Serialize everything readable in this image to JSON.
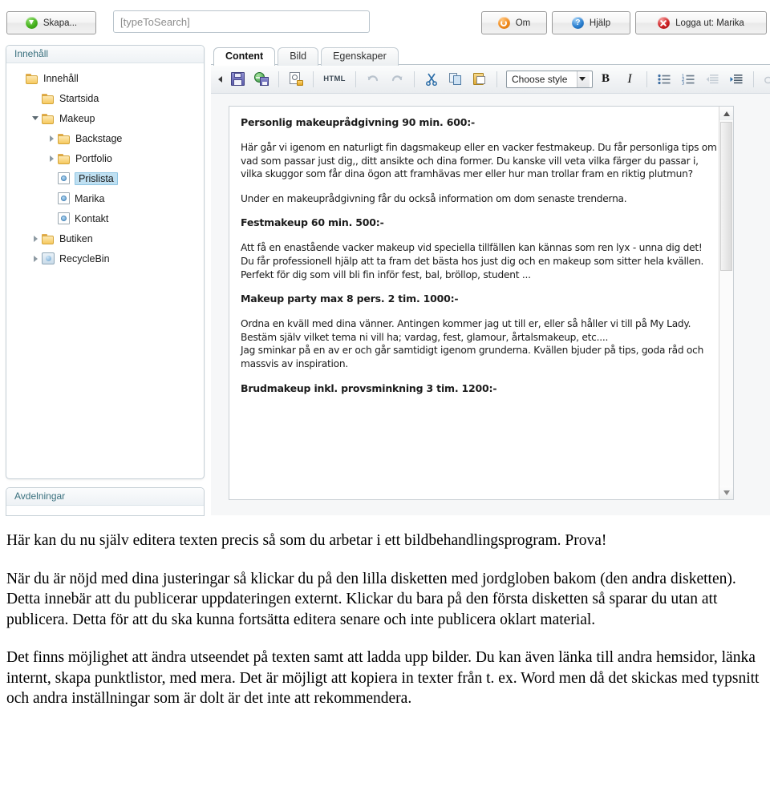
{
  "topbar": {
    "create_button": "Skapa...",
    "search_placeholder": "[typeToSearch]",
    "search_value": "",
    "about_button": "Om",
    "help_button": "Hjälp",
    "logout_button": "Logga ut: Marika"
  },
  "sidebar": {
    "header": "Innehåll",
    "footer_header": "Avdelningar",
    "items": [
      {
        "label": "Innehåll",
        "icon": "folder-icon",
        "twist": "none",
        "depth": 0,
        "selected": false
      },
      {
        "label": "Startsida",
        "icon": "folder-icon",
        "twist": "none",
        "depth": 1,
        "selected": false
      },
      {
        "label": "Makeup",
        "icon": "folder-icon",
        "twist": "open",
        "depth": 1,
        "selected": false
      },
      {
        "label": "Backstage",
        "icon": "folder-icon",
        "twist": "closed",
        "depth": 2,
        "selected": false
      },
      {
        "label": "Portfolio",
        "icon": "folder-icon",
        "twist": "closed",
        "depth": 2,
        "selected": false
      },
      {
        "label": "Prislista",
        "icon": "page-icon",
        "twist": "none",
        "depth": 2,
        "selected": true
      },
      {
        "label": "Marika",
        "icon": "page-icon",
        "twist": "none",
        "depth": 2,
        "selected": false
      },
      {
        "label": "Kontakt",
        "icon": "page-icon",
        "twist": "none",
        "depth": 2,
        "selected": false
      },
      {
        "label": "Butiken",
        "icon": "folder-icon",
        "twist": "closed",
        "depth": 1,
        "selected": false
      },
      {
        "label": "RecycleBin",
        "icon": "recyclebin-icon",
        "twist": "closed",
        "depth": 1,
        "selected": false
      }
    ]
  },
  "editor": {
    "tabs": [
      {
        "label": "Content",
        "active": true
      },
      {
        "label": "Bild",
        "active": false
      },
      {
        "label": "Egenskaper",
        "active": false
      }
    ],
    "toolbar": {
      "collapse": "collapse-toolbar",
      "save": "save-icon",
      "save_publish": "save-and-publish-icon",
      "preview": "preview-icon",
      "html_label": "HTML",
      "undo": "undo-icon",
      "redo": "redo-icon",
      "cut": "cut-icon",
      "copy": "copy-icon",
      "paste": "paste-icon",
      "style_label": "Choose style",
      "bold_label": "B",
      "italic_label": "I",
      "bullet_list": "bullet-list-icon",
      "numbered_list": "numbered-list-icon",
      "outdent": "outdent-icon",
      "indent": "indent-icon",
      "link": "link-icon"
    },
    "content": {
      "heading1": "Personlig makeuprådgivning 90 min. 600:-",
      "para1": "Här går vi igenom en naturligt fin dagsmakeup eller en vacker festmakeup. Du får personliga tips om vad som passar just dig,, ditt ansikte och dina former. Du kanske vill veta vilka färger du passar i, vilka skuggor som får dina ögon att framhävas mer eller hur man trollar fram en riktig plutmun?",
      "para2": "Under en makeuprådgivning får du också information om dom senaste trenderna.",
      "heading2": "Festmakeup 60 min. 500:-",
      "para3": "Att få en enastående vacker makeup vid speciella tillfällen kan kännas som ren lyx - unna dig det!",
      "para4": "Du får professionell hjälp att ta fram det bästa hos just dig och en makeup som sitter hela kvällen.",
      "para5": "Perfekt för dig som vill bli fin inför fest, bal, bröllop, student ...",
      "heading3": "Makeup party max 8 pers. 2 tim. 1000:-",
      "para6": "Ordna en kväll med dina vänner. Antingen kommer jag ut till er, eller så håller vi till på My Lady.",
      "para7": "Bestäm själv vilket tema ni vill ha; vardag, fest, glamour, årtalsmakeup, etc....",
      "para8": "Jag sminkar på en av er och går samtidigt igenom grunderna. Kvällen bjuder på tips, goda råd och massvis av inspiration.",
      "heading4": "Brudmakeup inkl. provsminkning  3 tim. 1200:-"
    }
  },
  "caption": {
    "paragraph1": "Här kan du nu själv editera texten precis så som du arbetar i ett bildbehandlingsprogram. Prova!",
    "paragraph2": "När du är nöjd med dina justeringar så klickar du på den lilla disketten med jordgloben bakom (den andra disketten). Detta innebär att du publicerar uppdateringen externt. Klickar du bara på den första disketten så sparar du utan att publicera. Detta för att du ska kunna fortsätta editera senare och inte publicera oklart material.",
    "paragraph3": "Det finns möjlighet att ändra utseendet på texten samt att ladda upp bilder. Du kan även länka till andra hemsidor, länka internt, skapa punktlistor, med mera. Det är möjligt att kopiera in texter från t. ex. Word men då det skickas med typsnitt och andra inställningar som är dolt är det inte att rekommendera."
  },
  "colors": {
    "accent_teal": "#39707e",
    "selection_blue": "#bfe0f2",
    "folder_yellow": "#f6c95f",
    "save_purple": "#5f5fae"
  }
}
